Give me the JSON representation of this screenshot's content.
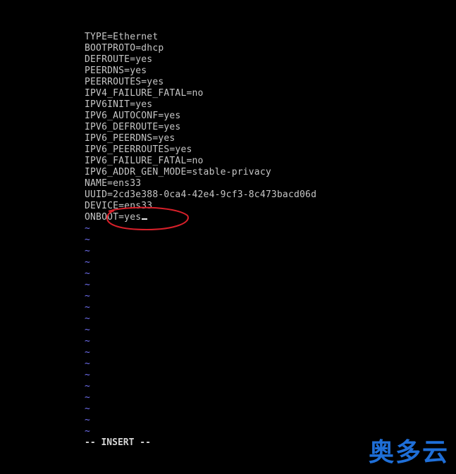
{
  "editor": {
    "lines": [
      "TYPE=Ethernet",
      "BOOTPROTO=dhcp",
      "DEFROUTE=yes",
      "PEERDNS=yes",
      "PEERROUTES=yes",
      "IPV4_FAILURE_FATAL=no",
      "IPV6INIT=yes",
      "IPV6_AUTOCONF=yes",
      "IPV6_DEFROUTE=yes",
      "IPV6_PEERDNS=yes",
      "IPV6_PEERROUTES=yes",
      "IPV6_FAILURE_FATAL=no",
      "IPV6_ADDR_GEN_MODE=stable-privacy",
      "NAME=ens33",
      "UUID=2cd3e388-0ca4-42e4-9cf3-8c473bacd06d",
      "DEVICE=ens33",
      "ONBOOT=yes"
    ],
    "empty_line_marker": "~",
    "empty_line_count": 19,
    "mode_indicator": "-- INSERT --"
  },
  "colors": {
    "background": "#000000",
    "text": "#c6c6c6",
    "tilde": "#6f6ff0",
    "annotation": "#d8202a",
    "watermark": "#1f6fd8"
  },
  "watermark": {
    "text": "奥多云"
  }
}
